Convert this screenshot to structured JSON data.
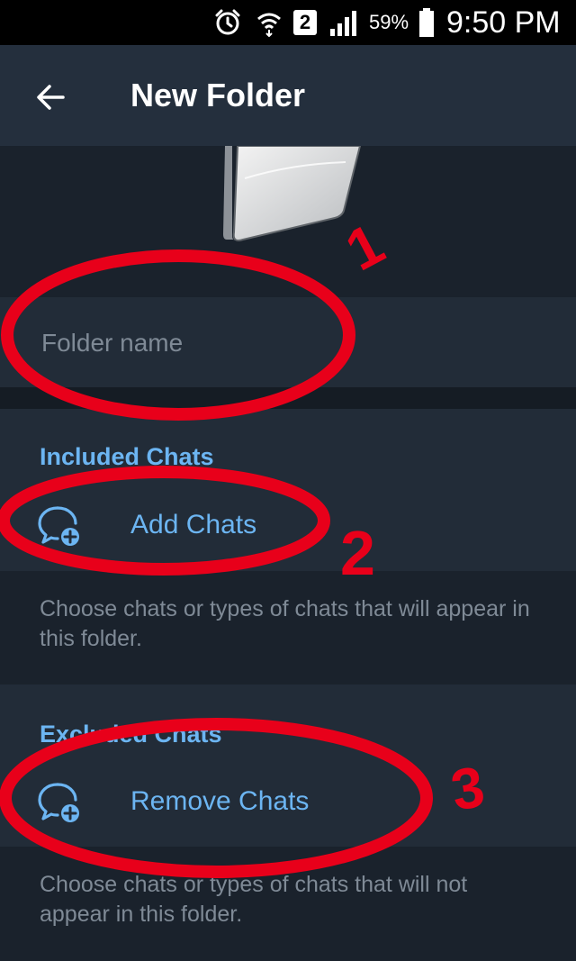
{
  "status_bar": {
    "icons": [
      "alarm-icon",
      "wifi-icon",
      "sim-2-icon",
      "signal-icon",
      "battery-icon"
    ],
    "sim_badge": "2",
    "battery_pct": "59%",
    "time": "9:50 PM"
  },
  "toolbar": {
    "back_icon": "arrow-left-icon",
    "title": "New Folder"
  },
  "folder_name": {
    "placeholder": "Folder name",
    "value": ""
  },
  "included": {
    "header": "Included Chats",
    "action_label": "Add Chats",
    "action_icon": "chat-add-icon",
    "hint": "Choose chats or types of chats that will appear in this folder."
  },
  "excluded": {
    "header": "Excluded Chats",
    "action_label": "Remove Chats",
    "action_icon": "chat-add-icon",
    "hint": "Choose chats or types of chats that will not appear in this folder."
  },
  "annotations": {
    "color": "#e8001a",
    "labels": [
      "1",
      "2",
      "3"
    ]
  },
  "colors": {
    "accent": "#6cb5f2",
    "background": "#1d2733",
    "toolbar": "#242f3d",
    "hint_text": "#7f8a96"
  }
}
